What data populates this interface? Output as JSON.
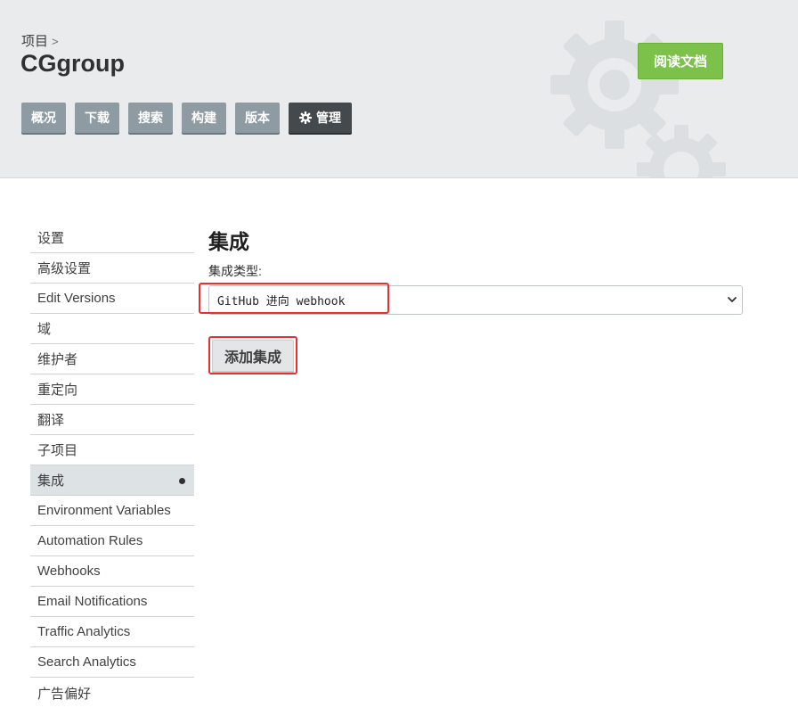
{
  "header": {
    "breadcrumb": "项目",
    "breadcrumb_separator": ">",
    "project_name": "CGgroup",
    "docs_button": "阅读文档"
  },
  "nav": {
    "tabs": [
      {
        "label": "概况",
        "icon": "",
        "active": false
      },
      {
        "label": "下载",
        "icon": "",
        "active": false
      },
      {
        "label": "搜索",
        "icon": "",
        "active": false
      },
      {
        "label": "构建",
        "icon": "",
        "active": false
      },
      {
        "label": "版本",
        "icon": "",
        "active": false
      },
      {
        "label": "管理",
        "icon": "gear-icon",
        "active": true
      }
    ]
  },
  "sidebar": {
    "items": [
      {
        "label": "设置"
      },
      {
        "label": "高级设置"
      },
      {
        "label": "Edit Versions"
      },
      {
        "label": "域"
      },
      {
        "label": "维护者"
      },
      {
        "label": "重定向"
      },
      {
        "label": "翻译"
      },
      {
        "label": "子项目"
      },
      {
        "label": "集成",
        "active": true
      },
      {
        "label": "Environment Variables"
      },
      {
        "label": "Automation Rules"
      },
      {
        "label": "Webhooks"
      },
      {
        "label": "Email Notifications"
      },
      {
        "label": "Traffic Analytics"
      },
      {
        "label": "Search Analytics"
      },
      {
        "label": "广告偏好"
      }
    ]
  },
  "main": {
    "title": "集成",
    "integration_type_label": "集成类型:",
    "integration_type_value": "GitHub 进向 webhook",
    "add_button": "添加集成"
  },
  "colors": {
    "header_bg": "#e9ebec",
    "nav_button": "#8e9ba3",
    "nav_button_active": "#43494d",
    "docs_button": "#7cc24a",
    "highlight": "#e8312c",
    "sidebar_active": "#dde2e5"
  }
}
